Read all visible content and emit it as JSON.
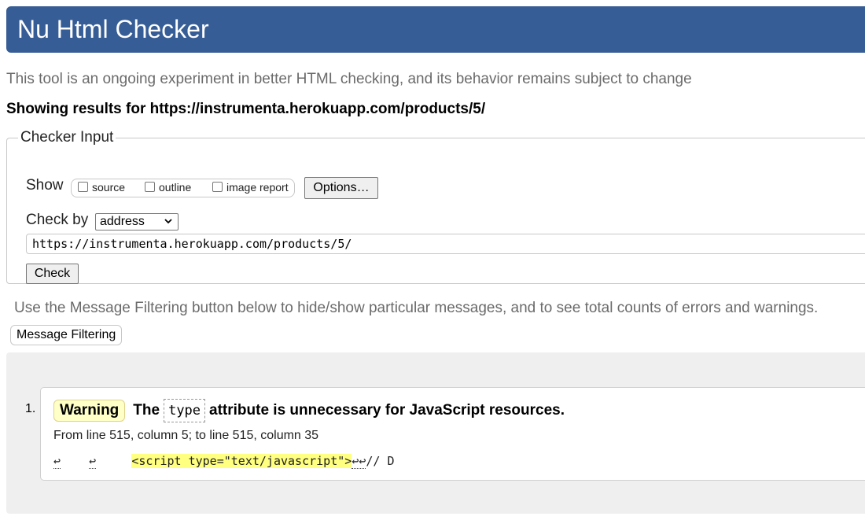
{
  "header": {
    "title": "Nu Html Checker"
  },
  "intro": "This tool is an ongoing experiment in better HTML checking, and its behavior remains subject to change",
  "showing_results": "Showing results for https://instrumenta.herokuapp.com/products/5/",
  "checker": {
    "legend": "Checker Input",
    "show_label": "Show",
    "options": [
      {
        "label": "source",
        "checked": false
      },
      {
        "label": "outline",
        "checked": false
      },
      {
        "label": "image report",
        "checked": false
      }
    ],
    "options_button": "Options…",
    "check_by_label": "Check by",
    "check_by_value": "address",
    "url_value": "https://instrumenta.herokuapp.com/products/5/",
    "check_button": "Check"
  },
  "filtering": {
    "hint": "Use the Message Filtering button below to hide/show particular messages, and to see total counts of errors and warnings.",
    "button": "Message Filtering"
  },
  "messages": [
    {
      "number": "1.",
      "type": "Warning",
      "text_before": "The",
      "code": "type",
      "text_after": "attribute is unnecessary for JavaScript resources.",
      "location": "From line 515, column 5; to line 515, column 35",
      "extract_prefix_1": "↩",
      "extract_prefix_2": "↩",
      "extract_highlight": "<script type=\"text/javascript\">",
      "extract_lf": "↩↩",
      "extract_suffix": "// D"
    }
  ],
  "colors": {
    "banner": "#365d95",
    "warning_badge": "#ffffc8",
    "highlight": "#ffff80",
    "panel": "#efefef"
  }
}
